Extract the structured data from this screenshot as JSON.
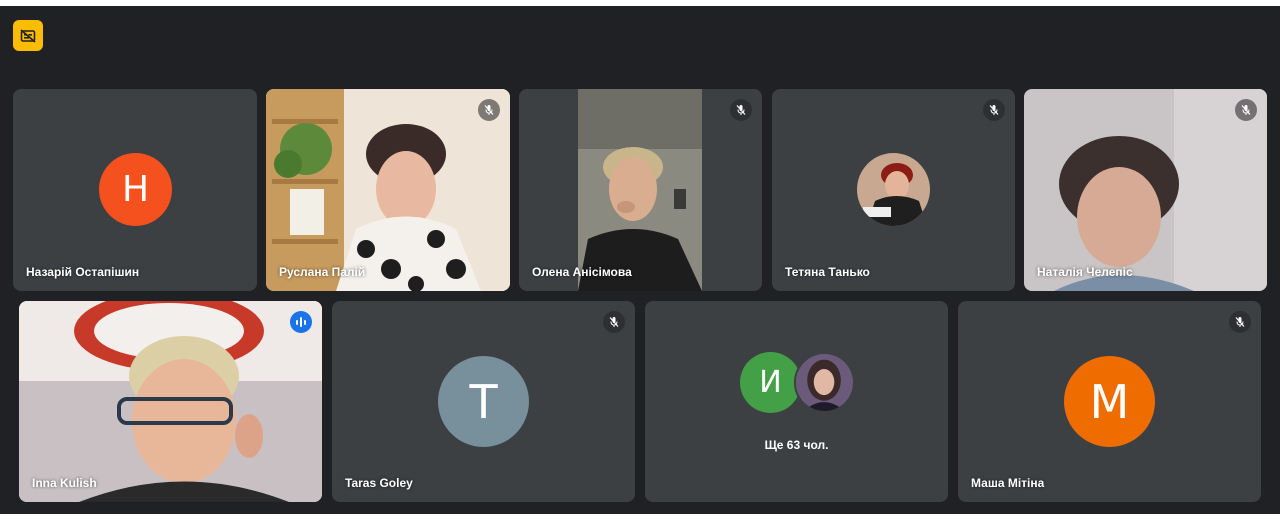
{
  "meeting": {
    "captions_icon": "captions-off-icon",
    "colors": {
      "background": "#202124",
      "tile": "#3c4043",
      "active_outline": "#8ab4f8",
      "speaking_badge": "#1a73e8",
      "captions_button": "#fbbc04"
    }
  },
  "participants": [
    {
      "name": "Назарій Остапішин",
      "initial": "Н",
      "avatar_color": "#f4511e",
      "muted": false
    },
    {
      "name": "Руслана Палій",
      "muted": true,
      "video": true
    },
    {
      "name": "Олена Анісімова",
      "muted": true,
      "video": true
    },
    {
      "name": "Тетяна Танько",
      "muted": true,
      "video": false,
      "has_photo_avatar": true
    },
    {
      "name": "Наталія Челепіс",
      "muted": true,
      "video": true
    },
    {
      "name": "Inna Kulish",
      "muted": false,
      "video": true,
      "speaking": true
    },
    {
      "name": "Taras Goley",
      "initial": "T",
      "avatar_color": "#78909c",
      "muted": true
    },
    {
      "name": "Маша Мітіна",
      "initial": "M",
      "avatar_color": "#ef6c00",
      "muted": true
    }
  ],
  "others": {
    "initial": "И",
    "avatar_color": "#43a047",
    "label": "Ще 63 чол."
  }
}
